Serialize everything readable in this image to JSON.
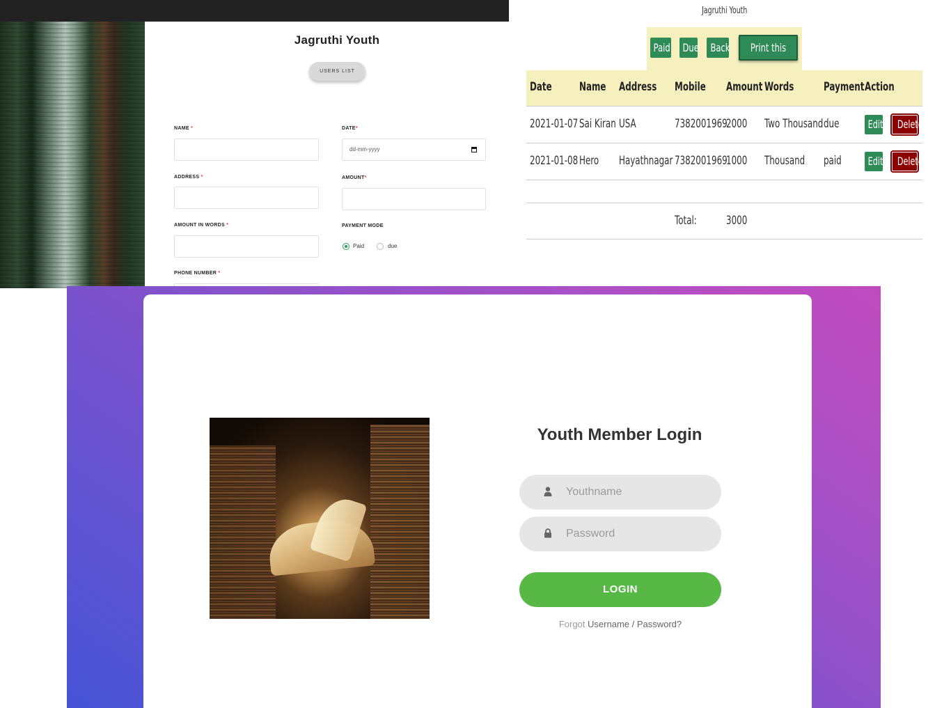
{
  "form_panel": {
    "title": "Jagruthi Youth",
    "users_list_button": "USERS LIST",
    "fields": {
      "name": {
        "label": "NAME",
        "value": ""
      },
      "date": {
        "label": "DATE",
        "placeholder": "dd-mm-yyyy"
      },
      "address": {
        "label": "ADDRESS",
        "value": ""
      },
      "amount": {
        "label": "AMOUNT",
        "value": ""
      },
      "amount_in_words": {
        "label": "AMOUNT IN WORDS",
        "value": ""
      },
      "payment_mode": {
        "label": "PAYMENT MODE",
        "options": [
          "Paid",
          "due"
        ],
        "selected": "Paid"
      },
      "phone_number": {
        "label": "PHONE NUMBER"
      }
    },
    "required_marker": "*"
  },
  "list_panel": {
    "title": "Jagruthi Youth",
    "buttons": {
      "paid": "Paid",
      "due": "Due",
      "back": "Back",
      "print": "Print this page"
    },
    "columns": [
      "Date",
      "Name",
      "Address",
      "Mobile",
      "Amount",
      "Words",
      "Payment",
      "Action"
    ],
    "rows": [
      {
        "date": "2021-01-07",
        "name": "Sai Kiran",
        "address": "USA",
        "mobile": "7382001969",
        "amount": "2000",
        "words": "Two Thousand",
        "payment": "due"
      },
      {
        "date": "2021-01-08",
        "name": "Hero",
        "address": "Hayathnagar",
        "mobile": "7382001969",
        "amount": "1000",
        "words": "Thousand",
        "payment": "paid"
      }
    ],
    "action_labels": {
      "edit": "Edit",
      "delete": "Delete"
    },
    "total_label": "Total:",
    "total_value": "3000",
    "colors": {
      "green": "#2e8b57",
      "dark_red": "#8b0000",
      "header_bg": "#f5f0be"
    }
  },
  "login_panel": {
    "title": "Youth Member Login",
    "username_placeholder": "Youthname",
    "password_placeholder": "Password",
    "login_button": "LOGIN",
    "forgot_prefix": "Forgot",
    "forgot_link": "Username / Password?",
    "icons": {
      "username": "user-icon",
      "password": "lock-icon"
    },
    "colors": {
      "button": "#57b846",
      "gradient_start": "#4654d6",
      "gradient_end": "#c14bbf"
    }
  }
}
